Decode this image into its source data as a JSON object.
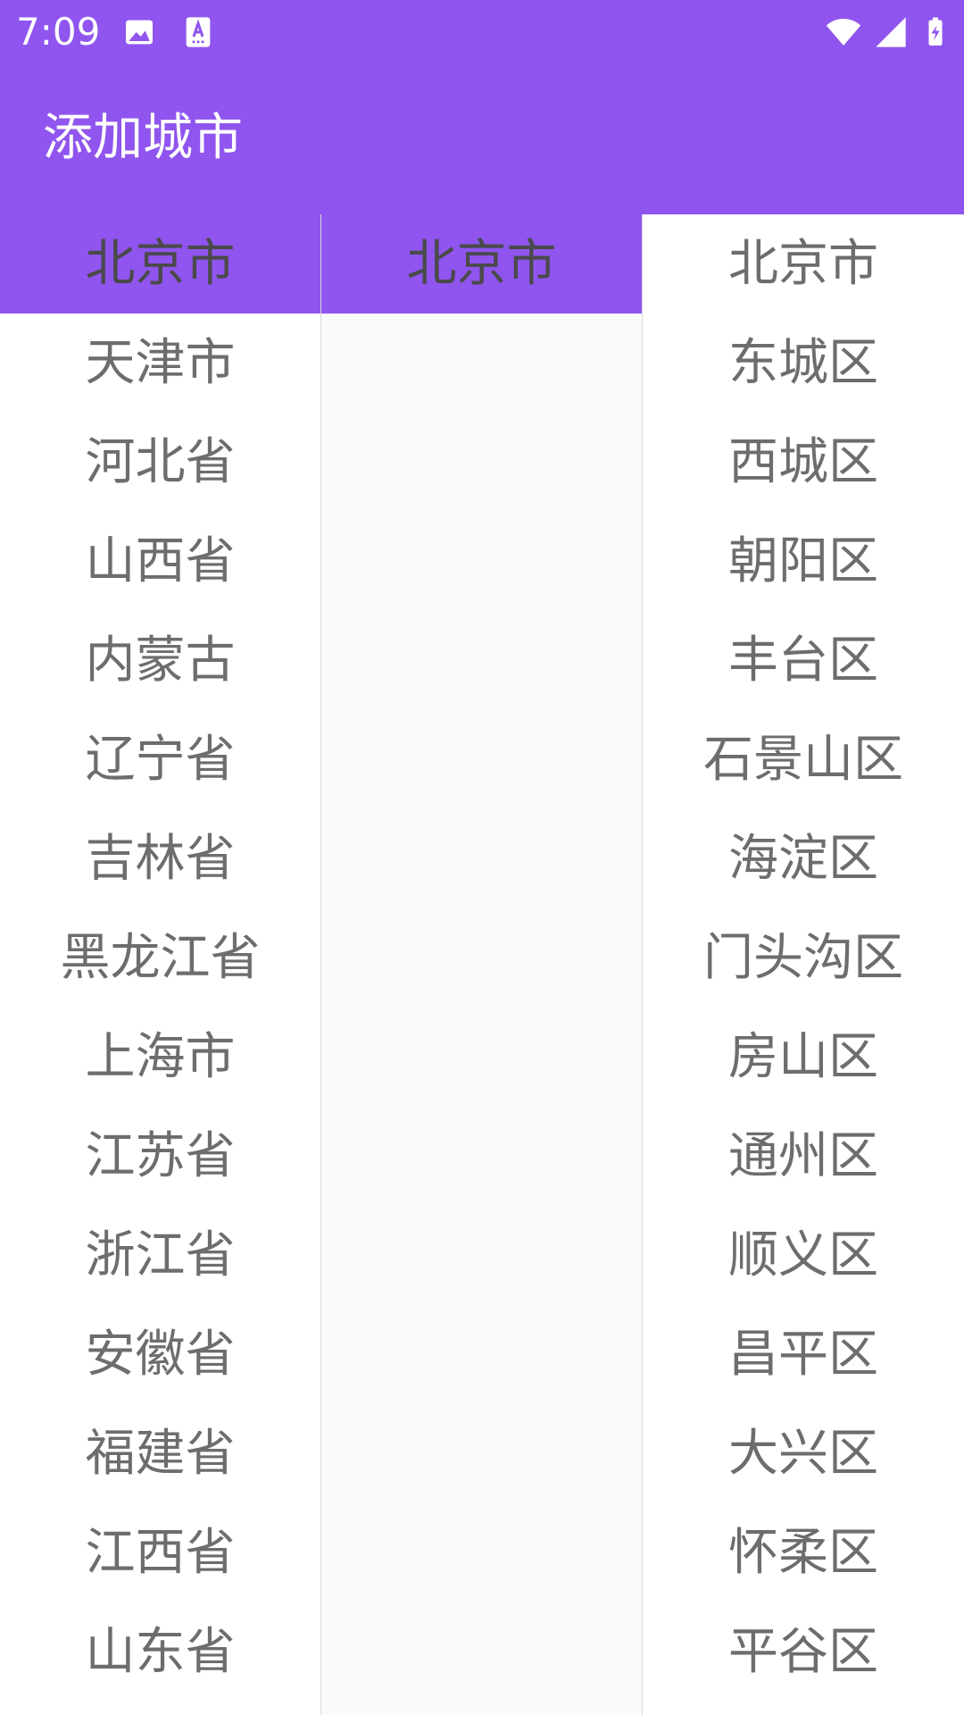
{
  "status_bar": {
    "time": "7:09",
    "icons": [
      "image-icon",
      "keyboard-a-icon",
      "wifi-icon",
      "signal-icon",
      "battery-charging-icon"
    ]
  },
  "app_bar": {
    "title": "添加城市"
  },
  "colors": {
    "accent": "#8f55ee",
    "text": "#6d6d6d"
  },
  "provinces": {
    "selected_index": 0,
    "items": [
      "北京市",
      "天津市",
      "河北省",
      "山西省",
      "内蒙古",
      "辽宁省",
      "吉林省",
      "黑龙江省",
      "上海市",
      "江苏省",
      "浙江省",
      "安徽省",
      "福建省",
      "江西省",
      "山东省"
    ]
  },
  "cities": {
    "selected_index": 0,
    "items": [
      "北京市"
    ]
  },
  "districts": {
    "items": [
      "北京市",
      "东城区",
      "西城区",
      "朝阳区",
      "丰台区",
      "石景山区",
      "海淀区",
      "门头沟区",
      "房山区",
      "通州区",
      "顺义区",
      "昌平区",
      "大兴区",
      "怀柔区",
      "平谷区"
    ]
  }
}
